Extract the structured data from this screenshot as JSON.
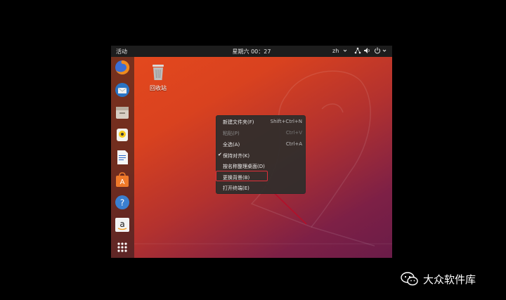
{
  "topbar": {
    "activities": "活动",
    "clock": "星期六 00：27",
    "language": "zh",
    "network_icon": "network-icon",
    "sound_icon": "volume-icon",
    "power_icon": "power-icon"
  },
  "dock": {
    "items": [
      {
        "name": "firefox",
        "icon": "firefox-icon"
      },
      {
        "name": "thunderbird",
        "icon": "thunderbird-icon"
      },
      {
        "name": "files",
        "icon": "files-icon"
      },
      {
        "name": "rhythmbox",
        "icon": "rhythmbox-icon"
      },
      {
        "name": "libreoffice-writer",
        "icon": "writer-icon"
      },
      {
        "name": "software",
        "icon": "software-icon"
      },
      {
        "name": "help",
        "icon": "help-icon"
      },
      {
        "name": "amazon",
        "icon": "amazon-icon"
      },
      {
        "name": "show-applications",
        "icon": "grid-icon"
      }
    ]
  },
  "desktop": {
    "trash_label": "回收站"
  },
  "context_menu": {
    "items": [
      {
        "label": "新建文件夹(F)",
        "accel": "Shift+Ctrl+N",
        "enabled": true,
        "checked": false
      },
      {
        "label": "粘贴(P)",
        "accel": "Ctrl+V",
        "enabled": false,
        "checked": false
      },
      {
        "label": "全选(A)",
        "accel": "Ctrl+A",
        "enabled": true,
        "checked": false
      },
      {
        "label": "保持对齐(K)",
        "accel": "",
        "enabled": true,
        "checked": true
      },
      {
        "label": "按名称整理桌面(D)",
        "accel": "",
        "enabled": true,
        "checked": false
      },
      {
        "label": "更换背景(B)",
        "accel": "",
        "enabled": true,
        "checked": false,
        "highlighted": true
      },
      {
        "label": "打开终端(E)",
        "accel": "",
        "enabled": true,
        "checked": false
      }
    ]
  },
  "watermark": {
    "text": "大众软件库"
  },
  "colors": {
    "highlight": "#e0303a",
    "topbar": "#1d1d1d",
    "menu_bg": "#302e2c"
  }
}
